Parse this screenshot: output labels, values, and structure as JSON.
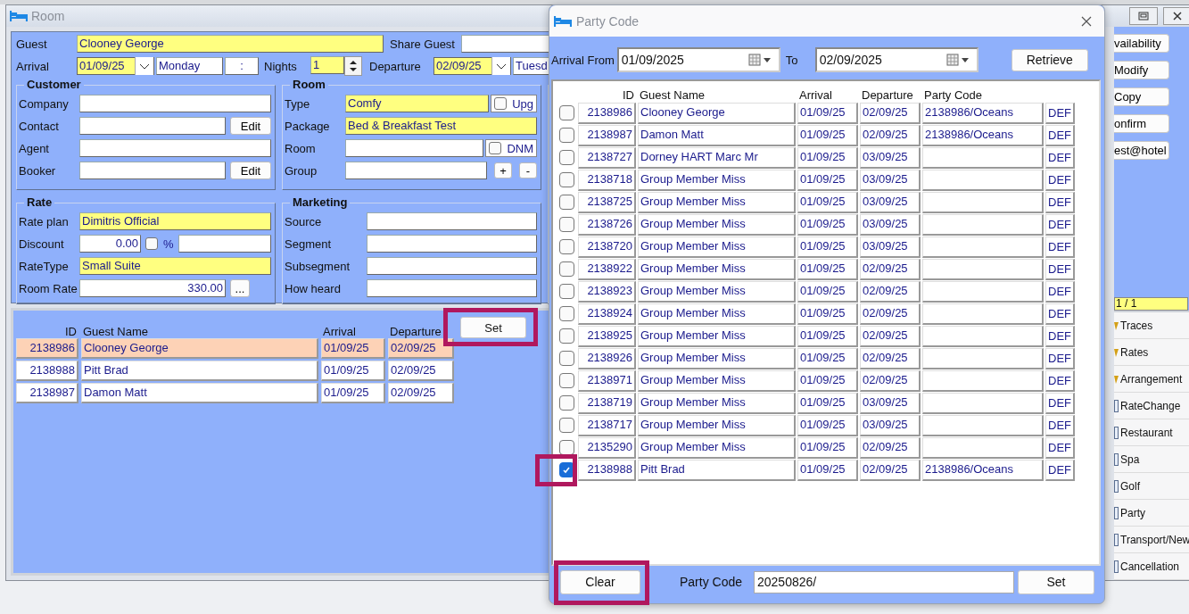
{
  "room_window": {
    "title": "Room",
    "guest": {
      "label": "Guest",
      "value": "Clooney George",
      "highlighted": true
    },
    "share_guest": {
      "label": "Share Guest"
    },
    "arrival": {
      "label": "Arrival",
      "date": "01/09/25",
      "highlighted": true,
      "weekday": "Monday",
      "time": ":"
    },
    "nights": {
      "label": "Nights",
      "value": "1",
      "highlighted": true
    },
    "departure": {
      "label": "Departure",
      "date": "02/09/25",
      "highlighted": true,
      "weekday": "Tuesd"
    },
    "customer": {
      "title": "Customer",
      "fields": [
        {
          "label": "Company",
          "highlighted": false
        },
        {
          "label": "Contact",
          "highlighted": false,
          "button": "Edit"
        },
        {
          "label": "Agent",
          "highlighted": false
        },
        {
          "label": "Booker",
          "highlighted": false,
          "button": "Edit"
        }
      ]
    },
    "room": {
      "title": "Room",
      "fields": [
        {
          "label": "Type",
          "value": "Comfy",
          "highlighted": true,
          "check": {
            "label": "Upg",
            "checked": false
          }
        },
        {
          "label": "Package",
          "value": "Bed & Breakfast Test",
          "highlighted": true
        },
        {
          "label": "Room",
          "highlighted": false,
          "check": {
            "label": "DNM",
            "checked": false
          }
        },
        {
          "label": "Group",
          "highlighted": false,
          "buttons": [
            "+",
            "-"
          ]
        }
      ]
    },
    "rate": {
      "title": "Rate",
      "fields": [
        {
          "label": "Rate plan",
          "value": "Dimitris Official",
          "highlighted": true
        },
        {
          "label": "Discount",
          "value": "0.00",
          "kind": "amount",
          "highlighted": false,
          "check": {
            "label": "%",
            "checked": false
          },
          "second_field": true
        },
        {
          "label": "RateType",
          "value": "Small Suite",
          "highlighted": true
        },
        {
          "label": "Room Rate",
          "value": "330.00",
          "kind": "amount",
          "highlighted": false,
          "button": "..."
        }
      ]
    },
    "marketing": {
      "title": "Marketing",
      "fields": [
        {
          "label": "Source",
          "highlighted": false
        },
        {
          "label": "Segment",
          "highlighted": false
        },
        {
          "label": "Subsegment",
          "highlighted": false
        },
        {
          "label": "How heard",
          "highlighted": false
        }
      ]
    },
    "sharers": {
      "columns": [
        "ID",
        "Guest Name",
        "Arrival",
        "Departure"
      ],
      "set_button": {
        "label": "Set",
        "highlighted": true
      },
      "rows": [
        {
          "id": "2138986",
          "name": "Clooney George",
          "arrival": "01/09/25",
          "departure": "02/09/25",
          "selected": true
        },
        {
          "id": "2138988",
          "name": "Pitt Brad",
          "arrival": "01/09/25",
          "departure": "02/09/25",
          "selected": false
        },
        {
          "id": "2138987",
          "name": "Damon Matt",
          "arrival": "01/09/25",
          "departure": "02/09/25",
          "selected": false
        }
      ]
    }
  },
  "side_panel": {
    "buttons": [
      "vailability",
      "Modify",
      "Copy",
      "onfirm",
      "est@hotel"
    ],
    "counter": "1 / 1",
    "tabs": [
      {
        "label": "Traces",
        "kind": "pin"
      },
      {
        "label": "Rates",
        "kind": "pin"
      },
      {
        "label": "Arrangement",
        "kind": "pin"
      },
      {
        "label": "RateChange",
        "kind": "page"
      },
      {
        "label": "Restaurant",
        "kind": "page"
      },
      {
        "label": "Spa",
        "kind": "page"
      },
      {
        "label": "Golf",
        "kind": "page"
      },
      {
        "label": "Party",
        "kind": "page"
      },
      {
        "label": "Transport/New",
        "kind": "page"
      },
      {
        "label": "Cancellation",
        "kind": "page"
      }
    ]
  },
  "party_dialog": {
    "title": "Party Code",
    "arrival_from": {
      "label": "Arrival From",
      "value": "01/09/2025"
    },
    "to": {
      "label": "To",
      "value": "02/09/2025"
    },
    "retrieve_button": "Retrieve",
    "columns": [
      "ID",
      "Guest Name",
      "Arrival",
      "Departure",
      "Party Code"
    ],
    "rows": [
      {
        "checked": false,
        "highlighted": false,
        "id": "2138986",
        "name": "Clooney George",
        "arrival": "01/09/25",
        "departure": "02/09/25",
        "party_code": "2138986/Oceans",
        "action": "DEF"
      },
      {
        "checked": false,
        "highlighted": false,
        "id": "2138987",
        "name": "Damon Matt",
        "arrival": "01/09/25",
        "departure": "02/09/25",
        "party_code": "2138986/Oceans",
        "action": "DEF"
      },
      {
        "checked": false,
        "highlighted": false,
        "id": "2138727",
        "name": "Dorney HART Marc Mr",
        "arrival": "01/09/25",
        "departure": "03/09/25",
        "action": "DEF"
      },
      {
        "checked": false,
        "highlighted": false,
        "id": "2138718",
        "name": "Group Member Miss",
        "arrival": "01/09/25",
        "departure": "03/09/25",
        "action": "DEF"
      },
      {
        "checked": false,
        "highlighted": false,
        "id": "2138725",
        "name": "Group Member Miss",
        "arrival": "01/09/25",
        "departure": "03/09/25",
        "action": "DEF"
      },
      {
        "checked": false,
        "highlighted": false,
        "id": "2138726",
        "name": "Group Member Miss",
        "arrival": "01/09/25",
        "departure": "03/09/25",
        "action": "DEF"
      },
      {
        "checked": false,
        "highlighted": false,
        "id": "2138720",
        "name": "Group Member Miss",
        "arrival": "01/09/25",
        "departure": "03/09/25",
        "action": "DEF"
      },
      {
        "checked": false,
        "highlighted": false,
        "id": "2138922",
        "name": "Group Member Miss",
        "arrival": "01/09/25",
        "departure": "02/09/25",
        "action": "DEF"
      },
      {
        "checked": false,
        "highlighted": false,
        "id": "2138923",
        "name": "Group Member Miss",
        "arrival": "01/09/25",
        "departure": "02/09/25",
        "action": "DEF"
      },
      {
        "checked": false,
        "highlighted": false,
        "id": "2138924",
        "name": "Group Member Miss",
        "arrival": "01/09/25",
        "departure": "02/09/25",
        "action": "DEF"
      },
      {
        "checked": false,
        "highlighted": false,
        "id": "2138925",
        "name": "Group Member Miss",
        "arrival": "01/09/25",
        "departure": "02/09/25",
        "action": "DEF"
      },
      {
        "checked": false,
        "highlighted": false,
        "id": "2138926",
        "name": "Group Member Miss",
        "arrival": "01/09/25",
        "departure": "02/09/25",
        "action": "DEF"
      },
      {
        "checked": false,
        "highlighted": false,
        "id": "2138971",
        "name": "Group Member Miss",
        "arrival": "01/09/25",
        "departure": "02/09/25",
        "action": "DEF"
      },
      {
        "checked": false,
        "highlighted": false,
        "id": "2138719",
        "name": "Group Member Miss",
        "arrival": "01/09/25",
        "departure": "03/09/25",
        "action": "DEF"
      },
      {
        "checked": false,
        "highlighted": false,
        "id": "2138717",
        "name": "Group Member Miss",
        "arrival": "01/09/25",
        "departure": "03/09/25",
        "action": "DEF"
      },
      {
        "checked": false,
        "highlighted": false,
        "id": "2135290",
        "name": "Group Member Miss",
        "arrival": "01/09/25",
        "departure": "02/09/25",
        "action": "DEF"
      },
      {
        "checked": true,
        "highlighted": true,
        "id": "2138988",
        "name": "Pitt Brad",
        "arrival": "01/09/25",
        "departure": "02/09/25",
        "party_code": "2138986/Oceans",
        "action": "DEF"
      }
    ],
    "clear_button": {
      "label": "Clear",
      "highlighted": true
    },
    "party_code": {
      "label": "Party Code",
      "value": "20250826/"
    },
    "set_button": {
      "label": "Set",
      "highlighted": false
    }
  }
}
